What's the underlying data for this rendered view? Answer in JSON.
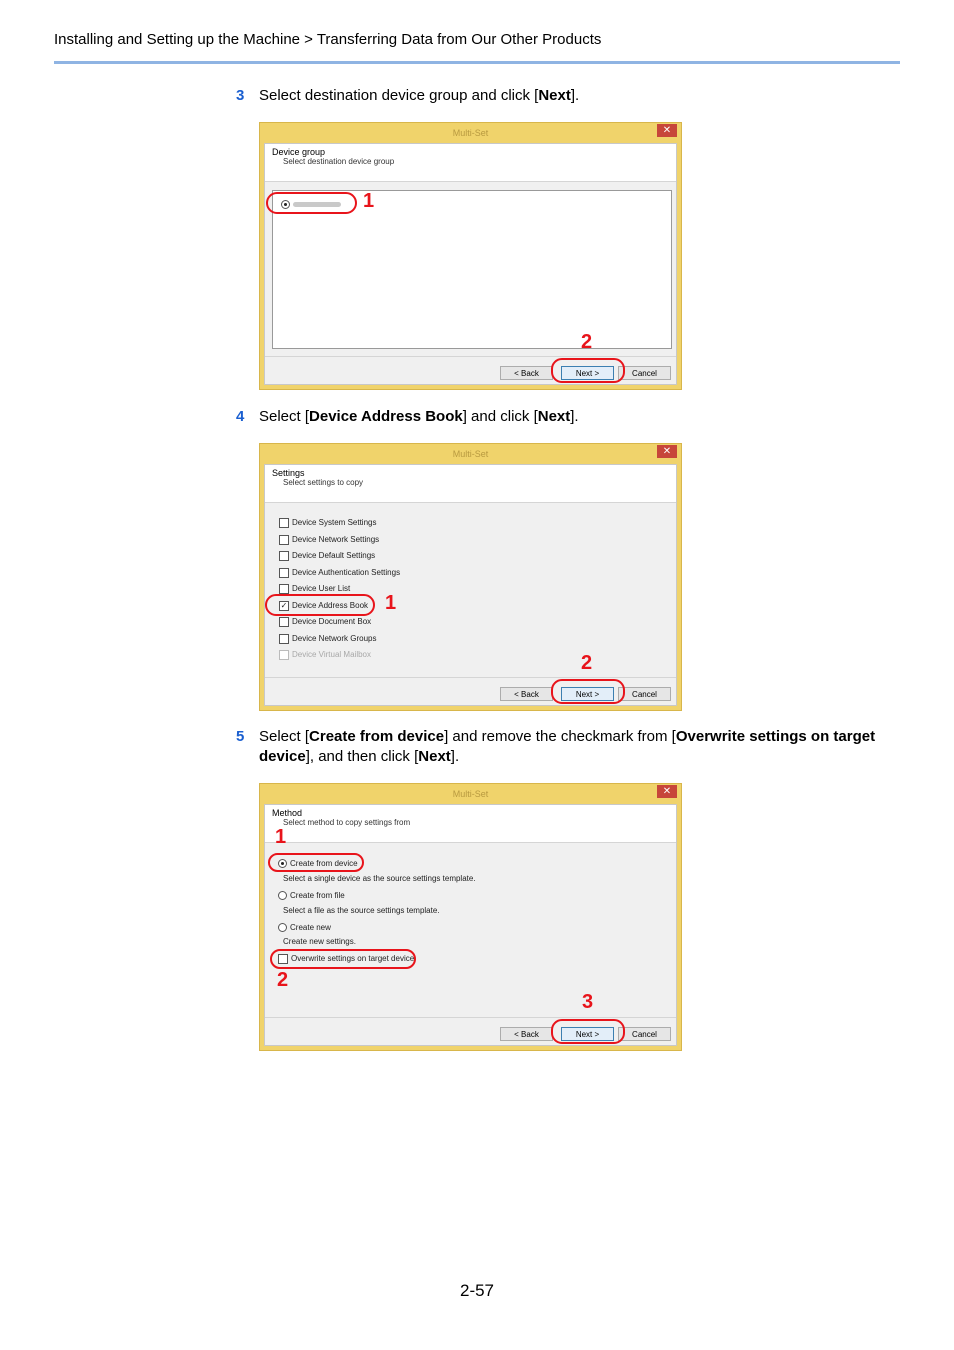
{
  "header": {
    "breadcrumb": "Installing and Setting up the Machine > Transferring Data from Our Other Products"
  },
  "steps": [
    {
      "num": "3",
      "t1": "Select destination device group and click [",
      "b1": "Next",
      "t2": "]."
    },
    {
      "num": "4",
      "t1": "Select [",
      "b1": "Device Address Book",
      "t2": "] and click [",
      "b2": "Next",
      "t3": "]."
    },
    {
      "num": "5",
      "t1": "Select [",
      "b1": "Create from device",
      "t2": "] and remove the checkmark from [",
      "b2": "Overwrite settings on target device",
      "t3": "], and then click [",
      "b3": "Next",
      "t4": "]."
    }
  ],
  "dialogs": {
    "common": {
      "title": "Multi-Set",
      "close": "✕",
      "back": "< Back",
      "next": "Next >",
      "cancel": "Cancel"
    },
    "group": {
      "heading": "Device group",
      "subheading": "Select destination device group"
    },
    "settings": {
      "heading": "Settings",
      "subheading": "Select settings to copy",
      "items": [
        {
          "label": "Device System Settings",
          "checked": false
        },
        {
          "label": "Device Network Settings",
          "checked": false
        },
        {
          "label": "Device Default Settings",
          "checked": false
        },
        {
          "label": "Device Authentication Settings",
          "checked": false
        },
        {
          "label": "Device User List",
          "checked": false
        },
        {
          "label": "Device Address Book",
          "checked": true
        },
        {
          "label": "Device Document Box",
          "checked": false
        },
        {
          "label": "Device Network Groups",
          "checked": false
        },
        {
          "label": "Device Virtual Mailbox",
          "checked": false,
          "disabled": true
        }
      ]
    },
    "method": {
      "heading": "Method",
      "subheading": "Select method to copy settings from",
      "options": [
        {
          "label": "Create from device",
          "desc": "Select a single device as the source settings template.",
          "selected": true
        },
        {
          "label": "Create from file",
          "desc": "Select a file as the source settings template.",
          "selected": false
        },
        {
          "label": "Create new",
          "desc": "Create new settings.",
          "selected": false
        }
      ],
      "overwrite_label": "Overwrite settings on target device",
      "overwrite_checked": false
    }
  },
  "callouts": {
    "one": "1",
    "two": "2",
    "three": "3"
  },
  "page_number": "2-57"
}
